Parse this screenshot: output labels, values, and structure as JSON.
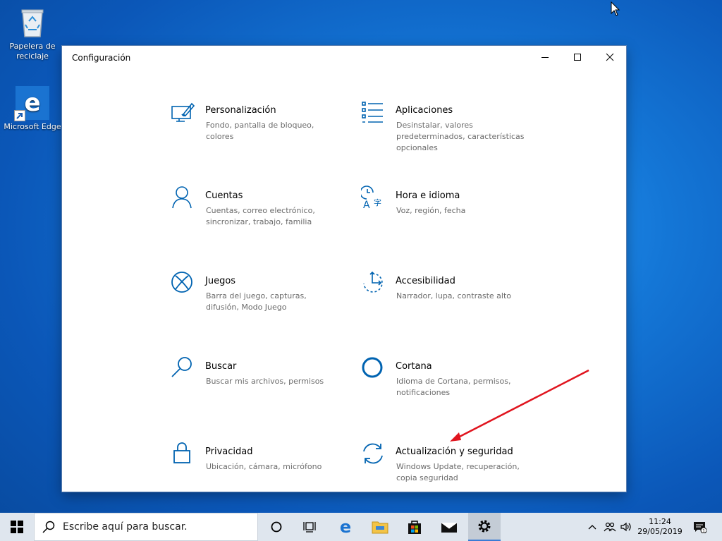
{
  "desktop": {
    "icons": [
      {
        "label": "Papelera de reciclaje",
        "icon": "recycle-bin-icon"
      },
      {
        "label": "Microsoft Edge",
        "icon": "edge-icon"
      }
    ]
  },
  "window": {
    "title": "Configuración",
    "controls": [
      "minimize",
      "maximize",
      "close"
    ]
  },
  "categories": [
    {
      "name": "Personalización",
      "desc": "Fondo, pantalla de bloqueo, colores",
      "icon": "personalization-icon"
    },
    {
      "name": "Aplicaciones",
      "desc": "Desinstalar, valores predeterminados, características opcionales",
      "icon": "apps-icon"
    },
    {
      "name": "Cuentas",
      "desc": "Cuentas, correo electrónico, sincronizar, trabajo, familia",
      "icon": "accounts-icon"
    },
    {
      "name": "Hora e idioma",
      "desc": "Voz, región, fecha",
      "icon": "time-language-icon"
    },
    {
      "name": "Juegos",
      "desc": "Barra del juego, capturas, difusión, Modo Juego",
      "icon": "xbox-icon"
    },
    {
      "name": "Accesibilidad",
      "desc": "Narrador, lupa, contraste alto",
      "icon": "accessibility-icon"
    },
    {
      "name": "Buscar",
      "desc": "Buscar mis archivos, permisos",
      "icon": "search-icon"
    },
    {
      "name": "Cortana",
      "desc": "Idioma de Cortana, permisos, notificaciones",
      "icon": "cortana-icon"
    },
    {
      "name": "Privacidad",
      "desc": "Ubicación, cámara, micrófono",
      "icon": "lock-icon"
    },
    {
      "name": "Actualización y seguridad",
      "desc": "Windows Update, recuperación, copia seguridad",
      "icon": "update-icon"
    }
  ],
  "taskbar": {
    "search_placeholder": "Escribe aquí para buscar.",
    "pinned": [
      "cortana-icon",
      "task-view-icon",
      "edge-icon",
      "file-explorer-icon",
      "store-icon",
      "mail-icon",
      "settings-icon"
    ],
    "active": "settings-icon",
    "clock_time": "11:24",
    "clock_date": "29/05/2019",
    "notification_count": "1"
  },
  "colors": {
    "accent": "#0063b1",
    "annotation_arrow": "#e0141e"
  }
}
